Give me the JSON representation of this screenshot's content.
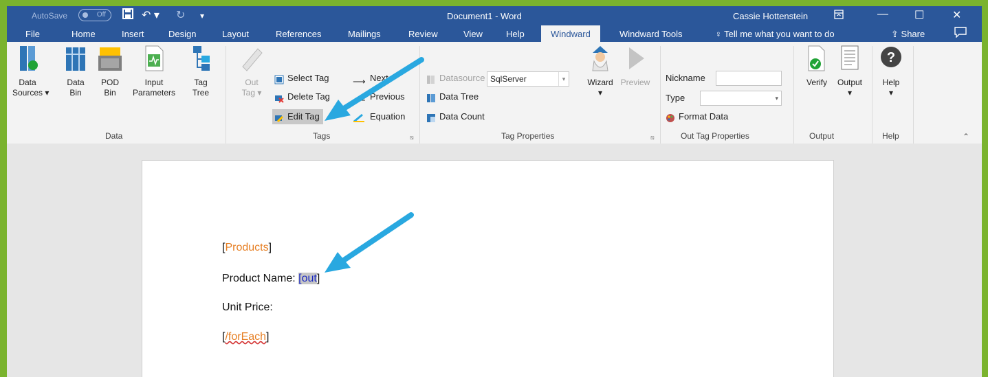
{
  "titlebar": {
    "autosave_label": "AutoSave",
    "autosave_state": "Off",
    "document_title": "Document1  -  Word",
    "user_name": "Cassie Hottenstein"
  },
  "tabs": [
    "File",
    "Home",
    "Insert",
    "Design",
    "Layout",
    "References",
    "Mailings",
    "Review",
    "View",
    "Help",
    "Windward",
    "Windward Tools"
  ],
  "active_tab": "Windward",
  "tell_me": "Tell me what you want to do",
  "share": "Share",
  "groups": {
    "data": {
      "label": "Data",
      "buttons": [
        {
          "l1": "Data",
          "l2": "Sources ▾"
        },
        {
          "l1": "Data",
          "l2": "Bin"
        },
        {
          "l1": "POD",
          "l2": "Bin"
        },
        {
          "l1": "Input",
          "l2": "Parameters"
        },
        {
          "l1": "Tag",
          "l2": "Tree"
        }
      ]
    },
    "tags": {
      "label": "Tags",
      "out_l1": "Out",
      "out_l2": "Tag ▾",
      "select_tag": "Select Tag",
      "delete_tag": "Delete Tag",
      "edit_tag": "Edit Tag",
      "next": "Next",
      "previous": "Previous",
      "equation": "Equation"
    },
    "tag_properties": {
      "label": "Tag Properties",
      "datasource_label": "Datasource",
      "datasource_value": "SqlServer",
      "data_tree": "Data Tree",
      "data_count": "Data Count",
      "wizard": "Wizard",
      "preview": "Preview"
    },
    "out_tag_properties": {
      "label": "Out Tag Properties",
      "nickname_label": "Nickname",
      "type_label": "Type",
      "format_data": "Format Data"
    },
    "output": {
      "label": "Output",
      "verify": "Verify",
      "output": "Output"
    },
    "help": {
      "label": "Help",
      "help": "Help"
    }
  },
  "document": {
    "line1_open": "[",
    "line1_tag": "Products",
    "line1_close": "]",
    "line2_text": "Product Name: ",
    "line2_open": "[",
    "line2_tag": "out",
    "line2_close": "]",
    "line3_text": "Unit Price:",
    "line4_open": "[",
    "line4_tag": "/forEach",
    "line4_close": "]"
  },
  "colors": {
    "frame": "#7ab32e",
    "titlebar": "#2b579a",
    "arrow": "#29a8e0",
    "tag_orange": "#e67e22"
  }
}
